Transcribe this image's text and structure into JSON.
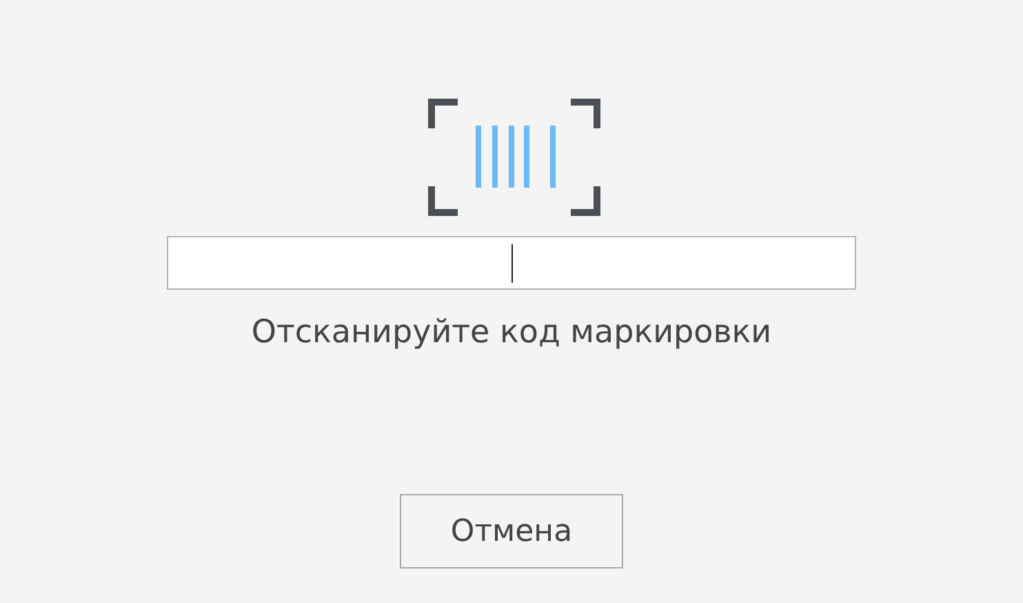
{
  "instruction": "Отсканируйте код маркировки",
  "buttons": [
    {
      "label": "Отмена"
    }
  ]
}
